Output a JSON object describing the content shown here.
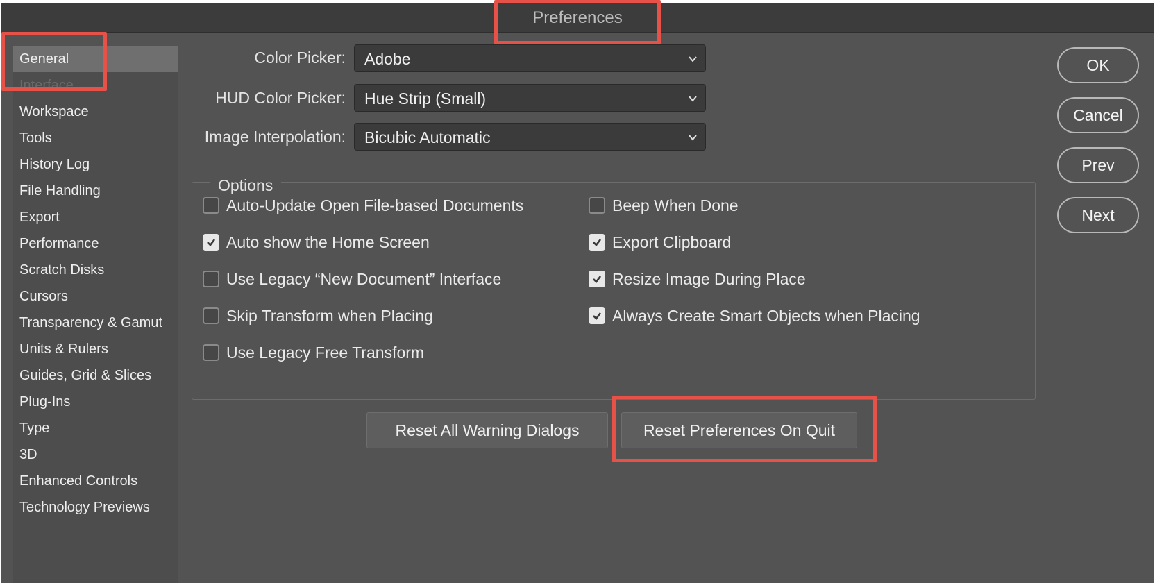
{
  "window": {
    "title": "Preferences"
  },
  "sidebar": {
    "items": [
      {
        "label": "General",
        "active": true
      },
      {
        "label": "Interface",
        "active": false
      },
      {
        "label": "Workspace",
        "active": false
      },
      {
        "label": "Tools",
        "active": false
      },
      {
        "label": "History Log",
        "active": false
      },
      {
        "label": "File Handling",
        "active": false
      },
      {
        "label": "Export",
        "active": false
      },
      {
        "label": "Performance",
        "active": false
      },
      {
        "label": "Scratch Disks",
        "active": false
      },
      {
        "label": "Cursors",
        "active": false
      },
      {
        "label": "Transparency & Gamut",
        "active": false
      },
      {
        "label": "Units & Rulers",
        "active": false
      },
      {
        "label": "Guides, Grid & Slices",
        "active": false
      },
      {
        "label": "Plug-Ins",
        "active": false
      },
      {
        "label": "Type",
        "active": false
      },
      {
        "label": "3D",
        "active": false
      },
      {
        "label": "Enhanced Controls",
        "active": false
      },
      {
        "label": "Technology Previews",
        "active": false
      }
    ]
  },
  "form": {
    "color_picker": {
      "label": "Color Picker:",
      "value": "Adobe"
    },
    "hud_color_picker": {
      "label": "HUD Color Picker:",
      "value": "Hue Strip (Small)"
    },
    "image_interpolation": {
      "label": "Image Interpolation:",
      "value": "Bicubic Automatic"
    }
  },
  "options": {
    "legend": "Options",
    "left": [
      {
        "label": "Auto-Update Open File-based Documents",
        "checked": false
      },
      {
        "label": "Auto show the Home Screen",
        "checked": true
      },
      {
        "label": "Use Legacy “New Document” Interface",
        "checked": false
      },
      {
        "label": "Skip Transform when Placing",
        "checked": false
      },
      {
        "label": "Use Legacy Free Transform",
        "checked": false
      }
    ],
    "right": [
      {
        "label": "Beep When Done",
        "checked": false
      },
      {
        "label": "Export Clipboard",
        "checked": true
      },
      {
        "label": "Resize Image During Place",
        "checked": true
      },
      {
        "label": "Always Create Smart Objects when Placing",
        "checked": true
      }
    ]
  },
  "actions": {
    "reset_warnings": "Reset All Warning Dialogs",
    "reset_prefs": "Reset Preferences On Quit"
  },
  "dialog_buttons": {
    "ok": "OK",
    "cancel": "Cancel",
    "prev": "Prev",
    "next": "Next"
  },
  "colors": {
    "highlight": "#e65247",
    "panel": "#535353",
    "titlebar": "#3c3c3c"
  }
}
